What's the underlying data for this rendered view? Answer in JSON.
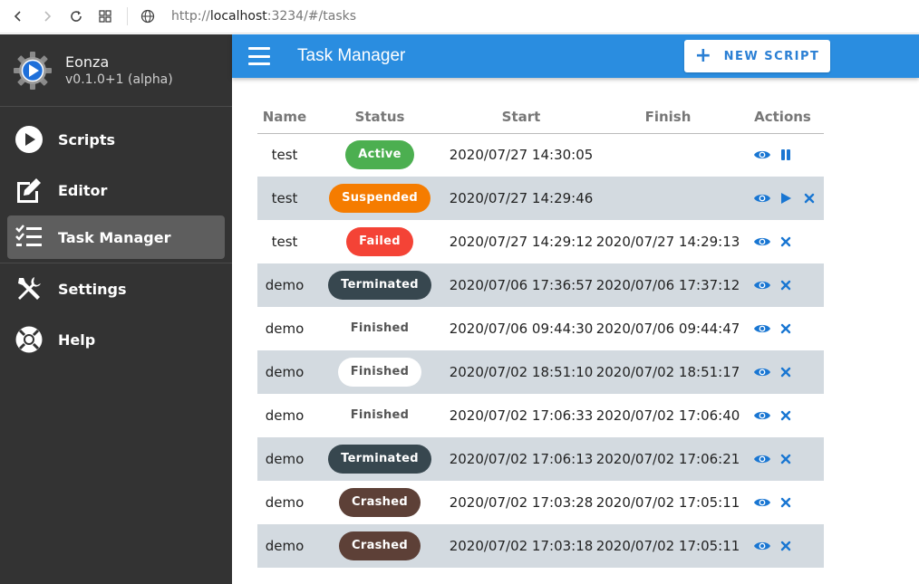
{
  "browser": {
    "url_prefix": "http://",
    "url_host": "localhost",
    "url_rest": ":3234/#/tasks"
  },
  "app": {
    "name": "Eonza",
    "version": "v0.1.0+1 (alpha)"
  },
  "menu": [
    {
      "label": "Scripts",
      "icon": "play-circle-icon"
    },
    {
      "label": "Editor",
      "icon": "edit-icon"
    },
    {
      "label": "Task Manager",
      "icon": "checklist-icon",
      "active": true
    },
    {
      "label": "Settings",
      "icon": "tools-icon"
    },
    {
      "label": "Help",
      "icon": "lifebuoy-icon"
    }
  ],
  "header": {
    "title": "Task Manager",
    "new_button": "NEW SCRIPT"
  },
  "table": {
    "columns": [
      "Name",
      "Status",
      "Start",
      "Finish",
      "Actions"
    ],
    "rows": [
      {
        "name": "test",
        "status": "Active",
        "start": "2020/07/27 14:30:05",
        "finish": "",
        "actions": [
          "view",
          "pause"
        ]
      },
      {
        "name": "test",
        "status": "Suspended",
        "start": "2020/07/27 14:29:46",
        "finish": "",
        "actions": [
          "view",
          "play",
          "close"
        ]
      },
      {
        "name": "test",
        "status": "Failed",
        "start": "2020/07/27 14:29:12",
        "finish": "2020/07/27 14:29:13",
        "actions": [
          "view",
          "close"
        ]
      },
      {
        "name": "demo",
        "status": "Terminated",
        "start": "2020/07/06 17:36:57",
        "finish": "2020/07/06 17:37:12",
        "actions": [
          "view",
          "close"
        ]
      },
      {
        "name": "demo",
        "status": "Finished",
        "start": "2020/07/06 09:44:30",
        "finish": "2020/07/06 09:44:47",
        "actions": [
          "view",
          "close"
        ]
      },
      {
        "name": "demo",
        "status": "Finished",
        "start": "2020/07/02 18:51:10",
        "finish": "2020/07/02 18:51:17",
        "actions": [
          "view",
          "close"
        ]
      },
      {
        "name": "demo",
        "status": "Finished",
        "start": "2020/07/02 17:06:33",
        "finish": "2020/07/02 17:06:40",
        "actions": [
          "view",
          "close"
        ]
      },
      {
        "name": "demo",
        "status": "Terminated",
        "start": "2020/07/02 17:06:13",
        "finish": "2020/07/02 17:06:21",
        "actions": [
          "view",
          "close"
        ]
      },
      {
        "name": "demo",
        "status": "Crashed",
        "start": "2020/07/02 17:03:28",
        "finish": "2020/07/02 17:05:11",
        "actions": [
          "view",
          "close"
        ]
      },
      {
        "name": "demo",
        "status": "Crashed",
        "start": "2020/07/02 17:03:18",
        "finish": "2020/07/02 17:05:11",
        "actions": [
          "view",
          "close"
        ]
      }
    ]
  },
  "status_colors": {
    "Active": "#4caf50",
    "Suspended": "#f57c00",
    "Failed": "#f44336",
    "Terminated": "#37474f",
    "Finished": "#ffffff",
    "Crashed": "#5d4037"
  },
  "colors": {
    "accent": "#2a8de0",
    "sidebar": "#333333",
    "row_alt": "#d3dae0",
    "action": "#1976d2"
  }
}
